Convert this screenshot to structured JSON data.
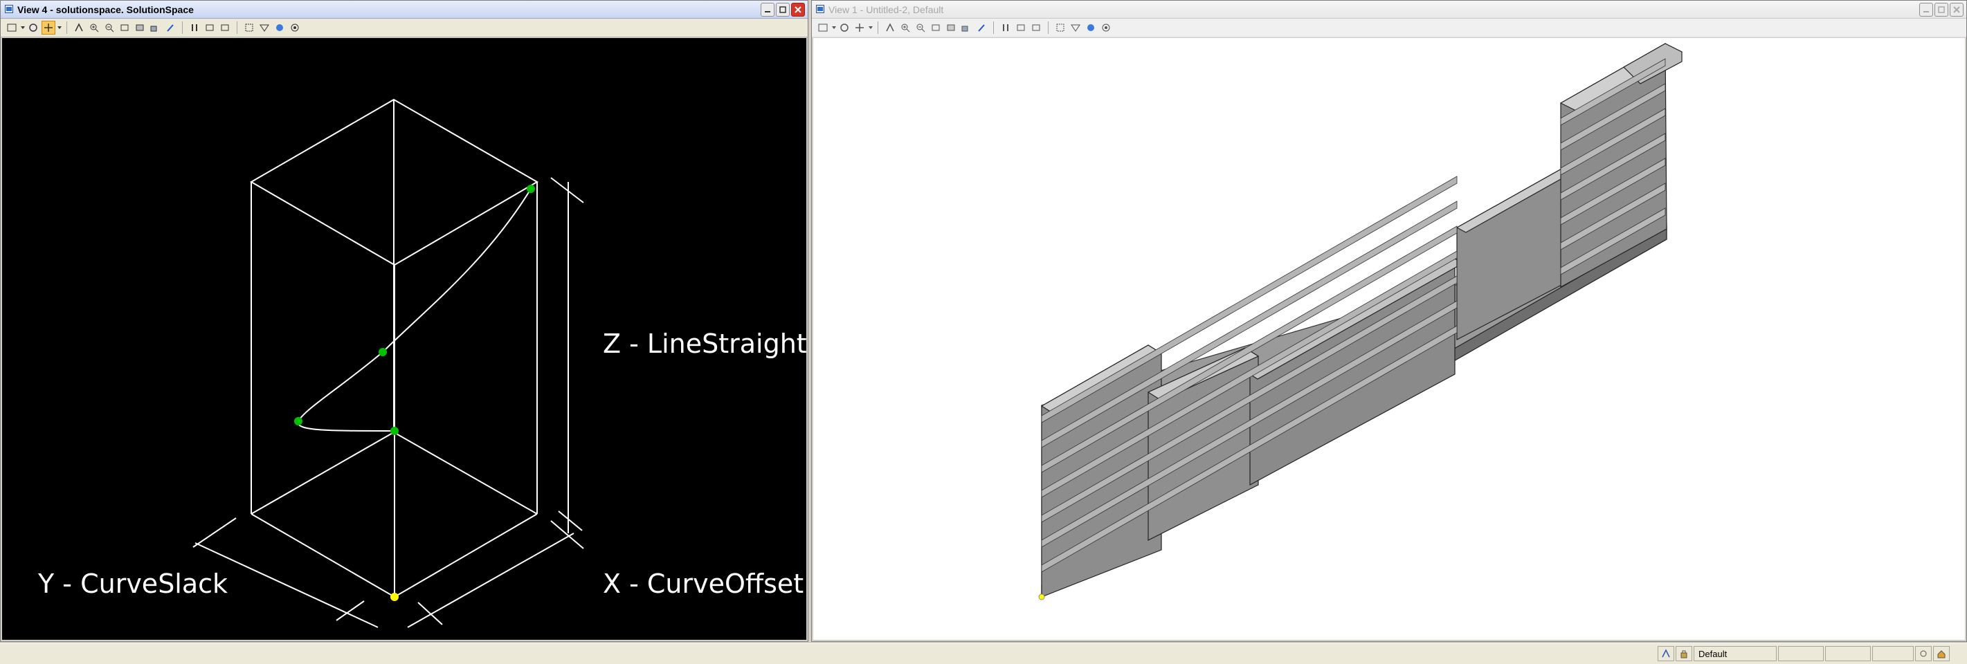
{
  "left_view": {
    "title": "View 4 - solutionspace. SolutionSpace",
    "labels": {
      "z": "Z - LineStraight",
      "y": "Y - CurveSlack",
      "x": "X - CurveOffset"
    }
  },
  "right_view": {
    "title": "View 1 - Untitled-2, Default"
  },
  "status_bar": {
    "view_name": "Default"
  },
  "icons": {
    "window": [
      "minimize-icon",
      "restore-icon",
      "close-icon"
    ],
    "toolbar": [
      "view-control-icon",
      "rotate-icon",
      "pan-icon",
      "fit-view-icon",
      "zoom-in-icon",
      "zoom-out-icon",
      "window-area-icon",
      "zoom-window-icon",
      "camera-icon",
      "copy-view-icon",
      "walk-icon",
      "previous-view-icon",
      "next-view-icon",
      "clip-volume-icon",
      "display-style-icon",
      "render-icon",
      "view-attributes-icon"
    ]
  },
  "colors": {
    "left_background": "#000000",
    "right_background": "#ffffff",
    "wireframe": "#ffffff",
    "point_green": "#00c000",
    "point_yellow": "#ffff00",
    "wall_gray": "#8c8c8c"
  }
}
